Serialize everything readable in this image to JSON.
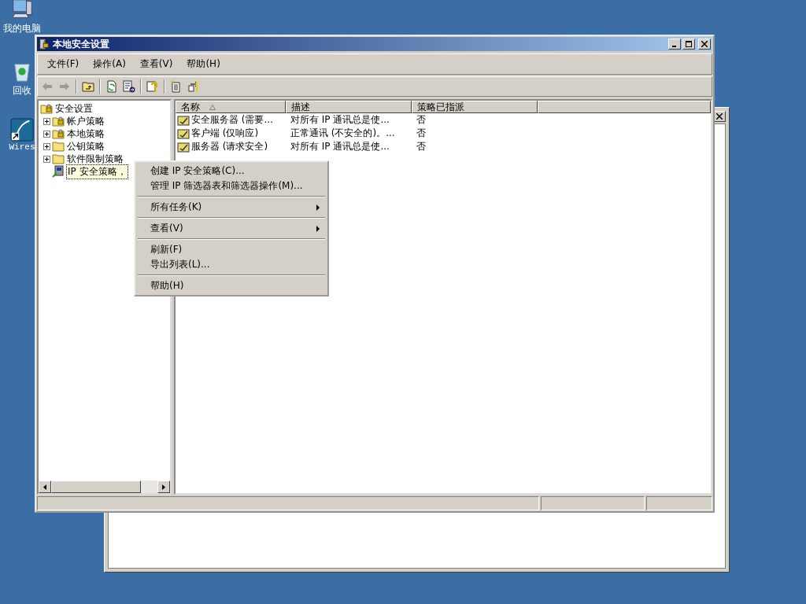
{
  "desktop_icons": [
    {
      "label": "我的电脑",
      "kind": "computer"
    },
    {
      "label": "回收",
      "kind": "recycle"
    },
    {
      "label": "Wires",
      "kind": "shortcut"
    }
  ],
  "background_window": {
    "kind": "window"
  },
  "window": {
    "title": "本地安全设置",
    "menu": [
      "文件(F)",
      "操作(A)",
      "查看(V)",
      "帮助(H)"
    ],
    "tree": {
      "label": "安全设置",
      "children": [
        {
          "label": "帐户策略",
          "kind": "lock-folder",
          "expandable": true,
          "selected": false
        },
        {
          "label": "本地策略",
          "kind": "lock-folder",
          "expandable": true,
          "selected": false
        },
        {
          "label": "公钥策略",
          "kind": "folder",
          "expandable": true,
          "selected": false
        },
        {
          "label": "软件限制策略",
          "kind": "folder",
          "expandable": true,
          "selected": false
        },
        {
          "label": "IP 安全策略，",
          "kind": "ip",
          "expandable": false,
          "selected": true
        }
      ]
    },
    "columns": [
      {
        "label": "名称",
        "sorted": true
      },
      {
        "label": "描述",
        "sorted": false
      },
      {
        "label": "策略已指派",
        "sorted": false
      }
    ],
    "rows": [
      [
        "安全服务器 (需要...",
        "对所有 IP 通讯总是使...",
        "否"
      ],
      [
        "客户端 (仅响应)",
        "正常通讯 (不安全的)。...",
        "否"
      ],
      [
        "服务器 (请求安全)",
        "对所有 IP 通讯总是使...",
        "否"
      ]
    ]
  },
  "context_menu": [
    {
      "kind": "item",
      "label": "创建 IP 安全策略(C)...",
      "submenu": false
    },
    {
      "kind": "item",
      "label": "管理 IP 筛选器表和筛选器操作(M)...",
      "submenu": false
    },
    {
      "kind": "separator"
    },
    {
      "kind": "item",
      "label": "所有任务(K)",
      "submenu": true
    },
    {
      "kind": "separator"
    },
    {
      "kind": "item",
      "label": "查看(V)",
      "submenu": true
    },
    {
      "kind": "separator"
    },
    {
      "kind": "item",
      "label": "刷新(F)",
      "submenu": false
    },
    {
      "kind": "item",
      "label": "导出列表(L)...",
      "submenu": false
    },
    {
      "kind": "separator"
    },
    {
      "kind": "item",
      "label": "帮助(H)",
      "submenu": false
    }
  ]
}
